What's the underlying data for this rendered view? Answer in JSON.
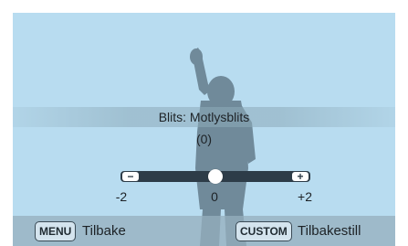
{
  "setting": {
    "title": "Blits: Motlysblits",
    "value": "(0)"
  },
  "slider": {
    "minus_symbol": "−",
    "plus_symbol": "+",
    "min_label": "-2",
    "mid_label": "0",
    "max_label": "+2",
    "current_value": 0,
    "range": [
      -2,
      2
    ]
  },
  "footer": {
    "menu_key": "MENU",
    "menu_action": "Tilbake",
    "custom_key": "CUSTOM",
    "custom_action": "Tilbakestill"
  },
  "colors": {
    "background": "#b8dcf0",
    "silhouette": "#647c8c",
    "track": "#2d3c48"
  }
}
